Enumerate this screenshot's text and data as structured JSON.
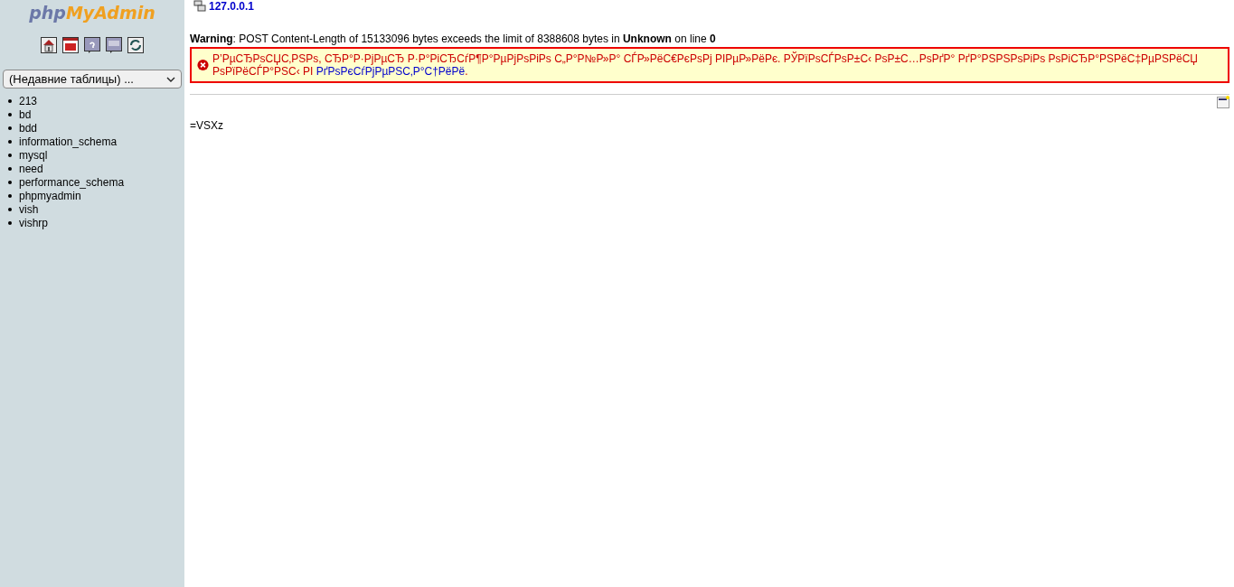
{
  "sidebar": {
    "logo_parts": [
      "php",
      "MyAdmin"
    ],
    "recent_tables": {
      "value": "(Недавние таблицы) ..."
    },
    "databases": [
      "213",
      "bd",
      "bdd",
      "information_schema",
      "mysql",
      "need",
      "performance_schema",
      "phpmyadmin",
      "vish",
      "vishrp"
    ]
  },
  "breadcrumb": {
    "server": "127.0.0.1"
  },
  "warning": "**Warning**: POST Content-Length of 15133096 bytes exceeds the limit of 8388608 bytes in **Unknown** on line **0**",
  "error": {
    "text": "Р’РµСЂРѕСЏС‚РЅРѕ, СЂР°Р·РјРµСЂ Р·Р°РіСЂСѓР¶Р°РµРјРѕРіРѕ С„Р°Р№Р»Р° СЃР»РёС€РєРѕРј РІРµР»РёРє. РЎРїРѕСЃРѕР±С‹ РѕР±С…РѕРґР° РґР°РЅРЅРѕРіРѕ РѕРіСЂР°РЅРёС‡РµРЅРёСЏ РѕРїРёСЃР°РЅС‹ РІ",
    "link": "РґРѕРєСѓРјРµРЅС‚Р°С†РёРё",
    "end": "."
  },
  "output": "=VSXz"
}
